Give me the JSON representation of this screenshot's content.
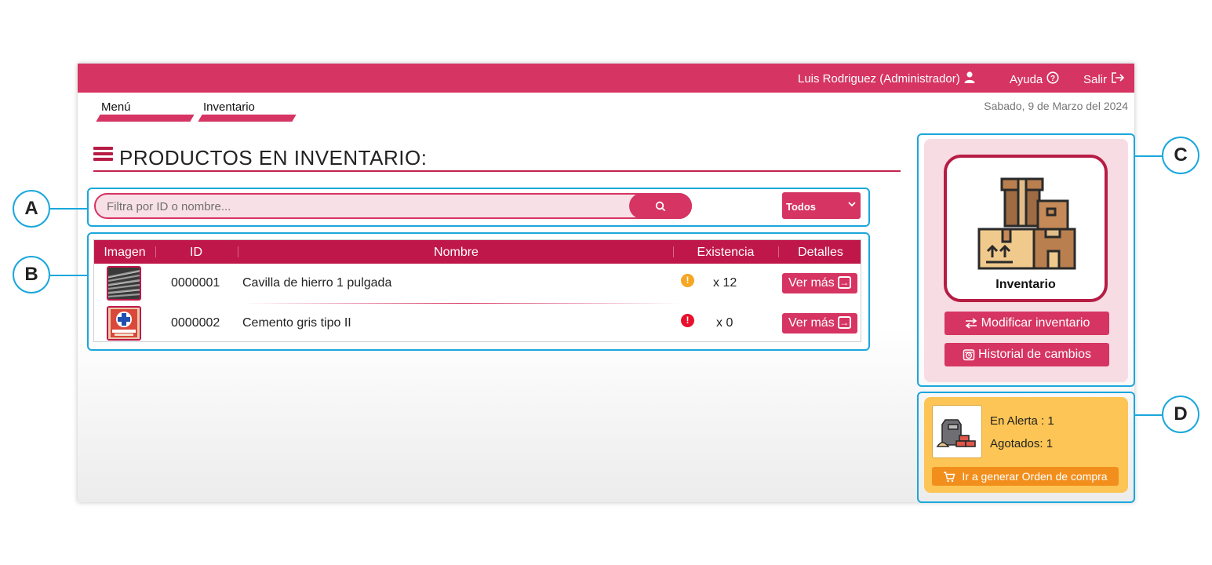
{
  "header": {
    "user_label": "Luis Rodriguez (Administrador)",
    "help_label": "Ayuda",
    "logout_label": "Salir",
    "bar_color": "#d63462"
  },
  "breadcrumb": {
    "items": [
      "Menú",
      "Inventario"
    ]
  },
  "date": "Sabado, 9 de Marzo del 2024",
  "page_title": "PRODUCTOS EN INVENTARIO:",
  "search": {
    "placeholder": "Filtra por ID o nombre...",
    "filter_value": "Todos"
  },
  "table": {
    "columns": [
      "Imagen",
      "ID",
      "Nombre",
      "Existencia",
      "Detalles"
    ],
    "rows": [
      {
        "id": "0000001",
        "name": "Cavilla de hierro 1 pulgada",
        "stock": "x 12",
        "status": "alerta",
        "status_color": "#f5a623",
        "details": "Ver más"
      },
      {
        "id": "0000002",
        "name": "Cemento gris tipo II",
        "stock": "x 0",
        "status": "agotado",
        "status_color": "#e8112d",
        "details": "Ver más"
      }
    ]
  },
  "side_panel": {
    "card_label": "Inventario",
    "modify_button": "Modificar inventario",
    "history_button": "Historial de cambios"
  },
  "alerts": {
    "alert_text": "En Alerta : 1",
    "out_text": "Agotados: 1",
    "order_button": "Ir a generar Orden de compra"
  },
  "annotations": [
    "A",
    "B",
    "C",
    "D"
  ],
  "accent_color": "#d63462",
  "callout_color": "#1aa7dc"
}
